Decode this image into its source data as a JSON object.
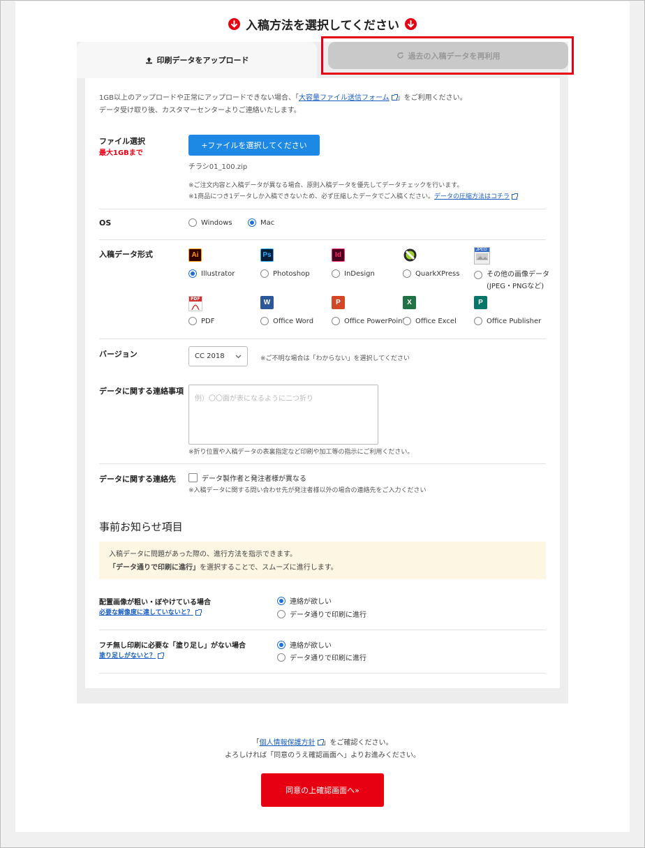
{
  "header": {
    "title": "入稿方法を選択してください"
  },
  "tabs": {
    "upload": "印刷データをアップロード",
    "reuse": "過去の入稿データを再利用"
  },
  "intro": {
    "line1_prefix": "1GB以上のアップロードや正常にアップロードできない場合、「",
    "line1_link": "大容量ファイル送信フォーム",
    "line1_suffix": "」をご利用ください。",
    "line2": "データ受け取り後、カスタマーセンターよりご連絡いたします。"
  },
  "file": {
    "label": "ファイル選択",
    "limit": "最大1GBまで",
    "button": "+ファイルを選択してください",
    "filename": "チラシ01_100.zip",
    "note1": "※ご注文内容と入稿データが異なる場合、原則入稿データを優先してデータチェックを行います。",
    "note2_prefix": "※1商品につき1データしか入稿できないため、必ず圧縮したデータでご入稿ください。",
    "note2_link": "データの圧縮方法はコチラ"
  },
  "os": {
    "label": "OS",
    "options": [
      "Windows",
      "Mac"
    ],
    "selected": "Mac"
  },
  "format": {
    "label": "入稿データ形式",
    "selected": "Illustrator",
    "row1": [
      {
        "name": "Illustrator",
        "icon": "illustrator-icon",
        "glyph": "Ai"
      },
      {
        "name": "Photoshop",
        "icon": "photoshop-icon",
        "glyph": "Ps"
      },
      {
        "name": "InDesign",
        "icon": "indesign-icon",
        "glyph": "Id"
      },
      {
        "name": "QuarkXPress",
        "icon": "quarkxpress-icon",
        "glyph": ""
      },
      {
        "name": "その他の画像データ",
        "sub": "(JPEG・PNGなど)",
        "icon": "jpeg-image-icon",
        "glyph": "JPEG"
      }
    ],
    "row2": [
      {
        "name": "PDF",
        "icon": "pdf-icon",
        "glyph": "PDF"
      },
      {
        "name": "Office Word",
        "icon": "word-icon",
        "glyph": "W"
      },
      {
        "name": "Office PowerPoint",
        "icon": "powerpoint-icon",
        "glyph": "P"
      },
      {
        "name": "Office Excel",
        "icon": "excel-icon",
        "glyph": "X"
      },
      {
        "name": "Office Publisher",
        "icon": "publisher-icon",
        "glyph": "P"
      }
    ]
  },
  "version": {
    "label": "バージョン",
    "value": "CC 2018",
    "note": "※ご不明な場合は「わからない」を選択してください"
  },
  "contact_note": {
    "label": "データに関する連絡事項",
    "placeholder": "例）〇〇面が表になるように二つ折り",
    "note": "※折り位置や入稿データの表裏指定など印刷や加工等の指示にご利用ください。"
  },
  "contact_to": {
    "label": "データに関する連絡先",
    "checkbox": "データ製作者と発注者様が異なる",
    "note": "※入稿データに関する問い合わせ先が発注者様以外の場合の連絡先をご入力ください"
  },
  "notice": {
    "heading": "事前お知らせ項目",
    "box_line1": "入稿データに問題があった際の、進行方法を指示できます。",
    "box_line2_bold": "「データ通りで印刷に進行」",
    "box_line2_rest": "を選択することで、スムーズに進行します。",
    "items": [
      {
        "label": "配置画像が粗い・ぼやけている場合",
        "link": "必要な解像度に達していないと？",
        "options": [
          "連絡が欲しい",
          "データ通りで印刷に進行"
        ],
        "selected": "連絡が欲しい"
      },
      {
        "label": "フチ無し印刷に必要な「塗り足し」がない場合",
        "link": "塗り足しがないと？",
        "options": [
          "連絡が欲しい",
          "データ通りで印刷に進行"
        ],
        "selected": "連絡が欲しい"
      }
    ]
  },
  "footer": {
    "line1_prefix": "「",
    "line1_link": "個人情報保護方針",
    "line1_suffix": "」をご確認ください。",
    "line2": "よろしければ「同意のうえ確認画面へ」よりお進みください。",
    "submit": "同意の上確認画面へ»"
  },
  "colors": {
    "accent": "#e60012",
    "primary": "#1e88e5",
    "info_bg": "#fdf6e3"
  }
}
